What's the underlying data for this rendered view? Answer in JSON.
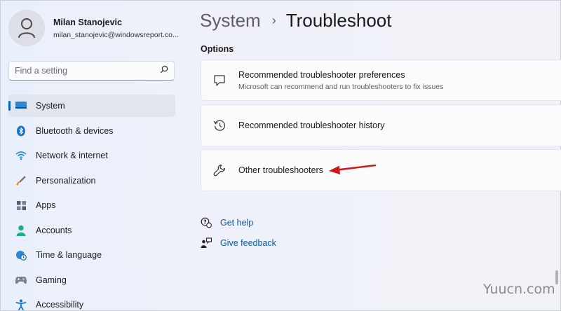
{
  "user": {
    "name": "Milan Stanojevic",
    "email": "milan_stanojevic@windowsreport.co..."
  },
  "search": {
    "placeholder": "Find a setting"
  },
  "nav": {
    "items": [
      {
        "label": "System",
        "icon": "monitor-icon",
        "active": true
      },
      {
        "label": "Bluetooth & devices",
        "icon": "bluetooth-icon"
      },
      {
        "label": "Network & internet",
        "icon": "wifi-icon"
      },
      {
        "label": "Personalization",
        "icon": "brush-icon"
      },
      {
        "label": "Apps",
        "icon": "apps-icon"
      },
      {
        "label": "Accounts",
        "icon": "person-icon"
      },
      {
        "label": "Time & language",
        "icon": "globe-clock-icon"
      },
      {
        "label": "Gaming",
        "icon": "gamepad-icon"
      },
      {
        "label": "Accessibility",
        "icon": "accessibility-icon"
      }
    ]
  },
  "header": {
    "parent": "System",
    "separator": "›",
    "current": "Troubleshoot"
  },
  "section": {
    "label": "Options"
  },
  "cards": [
    {
      "title": "Recommended troubleshooter preferences",
      "subtitle": "Microsoft can recommend and run troubleshooters to fix issues",
      "icon": "chat-bubble-icon"
    },
    {
      "title": "Recommended troubleshooter history",
      "icon": "history-icon"
    },
    {
      "title": "Other troubleshooters",
      "icon": "wrench-icon"
    }
  ],
  "links": [
    {
      "label": "Get help",
      "icon": "help-icon"
    },
    {
      "label": "Give feedback",
      "icon": "feedback-icon"
    }
  ],
  "watermark": "Yuucn.com",
  "colors": {
    "accent": "#0067c0",
    "link": "#0b5aa6",
    "arrow": "#d0191a"
  }
}
